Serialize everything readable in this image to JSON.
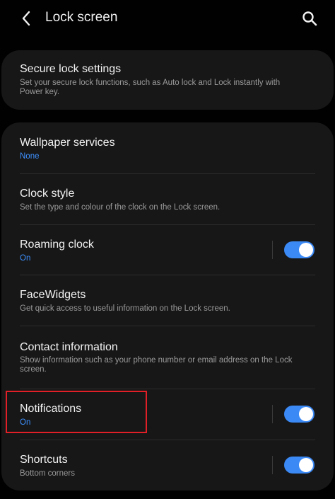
{
  "header": {
    "back_icon": "chevron-left-icon",
    "title": "Lock screen",
    "search_icon": "search-icon"
  },
  "secure_lock": {
    "title": "Secure lock settings",
    "subtitle": "Set your secure lock functions, such as Auto lock and Lock instantly with Power key."
  },
  "settings": [
    {
      "key": "wallpaper",
      "title": "Wallpaper services",
      "subtitle": "None",
      "subtitle_accent": true,
      "has_toggle": false
    },
    {
      "key": "clock",
      "title": "Clock style",
      "subtitle": "Set the type and colour of the clock on the Lock screen.",
      "subtitle_accent": false,
      "has_toggle": false
    },
    {
      "key": "roaming",
      "title": "Roaming clock",
      "subtitle": "On",
      "subtitle_accent": true,
      "has_toggle": true,
      "toggle_on": true
    },
    {
      "key": "facewidgets",
      "title": "FaceWidgets",
      "subtitle": "Get quick access to useful information on the Lock screen.",
      "subtitle_accent": false,
      "has_toggle": false
    },
    {
      "key": "contact",
      "title": "Contact information",
      "subtitle": "Show information such as your phone number or email address on the Lock screen.",
      "subtitle_accent": false,
      "has_toggle": false
    },
    {
      "key": "notifications",
      "title": "Notifications",
      "subtitle": "On",
      "subtitle_accent": true,
      "has_toggle": true,
      "toggle_on": true
    },
    {
      "key": "shortcuts",
      "title": "Shortcuts",
      "subtitle": "Bottom corners",
      "subtitle_accent": false,
      "has_toggle": true,
      "toggle_on": true
    }
  ],
  "colors": {
    "background": "#010101",
    "card": "#171717",
    "accent": "#3e91ff",
    "toggle_on": "#3b89f5",
    "highlight_box": "#e01f26"
  }
}
